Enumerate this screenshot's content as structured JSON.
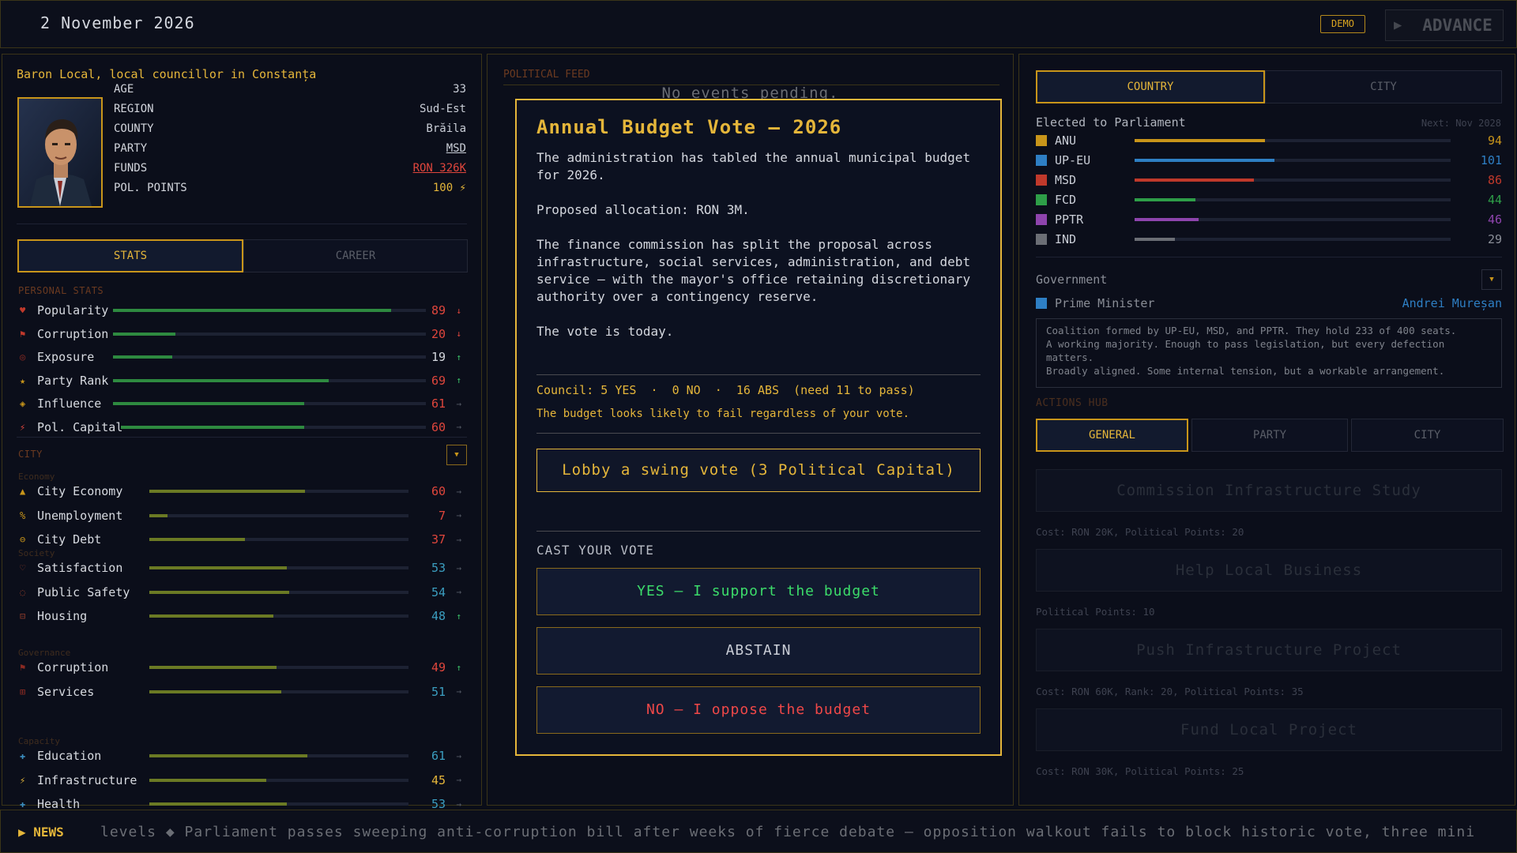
{
  "topbar": {
    "date": "2 November 2026",
    "demo_label": "DEMO",
    "advance_label": "ADVANCE"
  },
  "profile": {
    "name": "Baron Local, local councillor in Constanța",
    "fields": [
      {
        "key": "AGE",
        "value": "33"
      },
      {
        "key": "REGION",
        "value": "Sud-Est"
      },
      {
        "key": "COUNTY",
        "value": "Brăila"
      },
      {
        "key": "PARTY",
        "value": "MSD"
      },
      {
        "key": "FUNDS",
        "value": "RON 326K"
      },
      {
        "key": "POL. POINTS",
        "value": "100 ⚡"
      }
    ]
  },
  "left_tabs": {
    "stats": "STATS",
    "career": "CAREER"
  },
  "personal_stats": {
    "label": "PERSONAL STATS",
    "items": [
      {
        "icon": "heart-icon",
        "glyph": "♥",
        "name": "Popularity",
        "value": 89,
        "trend": "↓",
        "color": "#e0463c"
      },
      {
        "icon": "flag-icon",
        "glyph": "⚑",
        "name": "Corruption",
        "value": 20,
        "trend": "↓",
        "color": "#e0463c"
      },
      {
        "icon": "target-icon",
        "glyph": "◎",
        "name": "Exposure",
        "value": 19,
        "trend": "↑",
        "color": "#d4d7de"
      },
      {
        "icon": "star-icon",
        "glyph": "★",
        "name": "Party Rank",
        "value": 69,
        "trend": "↑",
        "color": "#e0463c"
      },
      {
        "icon": "diamond-icon",
        "glyph": "◈",
        "name": "Influence",
        "value": 61,
        "trend": "→",
        "color": "#e0463c"
      },
      {
        "icon": "bolt-icon",
        "glyph": "⚡",
        "name": "Pol. Capital",
        "value": 60,
        "trend": "→",
        "color": "#e0463c"
      }
    ]
  },
  "city": {
    "label": "CITY",
    "groups": [
      {
        "label": "Economy",
        "items": [
          {
            "glyph": "▲",
            "name": "City Economy",
            "value": 60,
            "trend": "→",
            "color": "#e0463c"
          },
          {
            "glyph": "%",
            "name": "Unemployment",
            "value": 7,
            "trend": "→",
            "color": "#e0463c"
          },
          {
            "glyph": "⊖",
            "name": "City Debt",
            "value": 37,
            "trend": "→",
            "color": "#e0463c"
          }
        ]
      },
      {
        "label": "Society",
        "items": [
          {
            "glyph": "♡",
            "name": "Satisfaction",
            "value": 53,
            "trend": "→",
            "color": "#3b9ec0"
          },
          {
            "glyph": "◌",
            "name": "Public Safety",
            "value": 54,
            "trend": "→",
            "color": "#3b9ec0"
          },
          {
            "glyph": "⊟",
            "name": "Housing",
            "value": 48,
            "trend": "↑",
            "color": "#3b9ec0"
          }
        ]
      },
      {
        "label": "Governance",
        "items": [
          {
            "glyph": "⚑",
            "name": "Corruption",
            "value": 49,
            "trend": "↑",
            "color": "#e0463c"
          },
          {
            "glyph": "⊞",
            "name": "Services",
            "value": 51,
            "trend": "→",
            "color": "#3b9ec0"
          }
        ]
      },
      {
        "label": "Capacity",
        "items": [
          {
            "glyph": "✚",
            "name": "Education",
            "value": 61,
            "trend": "→",
            "color": "#3b9ec0"
          },
          {
            "glyph": "⚡",
            "name": "Infrastructure",
            "value": 45,
            "trend": "→",
            "color": "#e5b63a"
          },
          {
            "glyph": "✚",
            "name": "Health",
            "value": 53,
            "trend": "→",
            "color": "#3b9ec0"
          }
        ]
      }
    ]
  },
  "feed": {
    "label": "POLITICAL FEED",
    "empty": "No events pending."
  },
  "modal": {
    "title": "Annual Budget Vote — 2026",
    "body": "The administration has tabled the annual municipal budget for 2026.\n\nProposed allocation: RON 3M.\n\nThe finance commission has split the proposal across infrastructure, social services, administration, and debt service — with the mayor's office retaining discretionary authority over a contingency reserve.\n\nThe vote is today.",
    "council": "Council: 5 YES  ·  0 NO  ·  16 ABS  (need 11 to pass)",
    "likely": "The budget looks likely to fail regardless of your vote.",
    "lobby": "Lobby a swing vote  (3 Political Capital)",
    "cast_label": "CAST YOUR VOTE",
    "yes": "YES — I support the budget",
    "abstain": "ABSTAIN",
    "no": "NO — I oppose the budget"
  },
  "right_tabs": {
    "country": "COUNTRY",
    "city": "CITY"
  },
  "parliament": {
    "label": "Elected to Parliament",
    "next": "Next: Nov 2028",
    "parties": [
      {
        "name": "ANU",
        "value": 94,
        "color": "#c8951a"
      },
      {
        "name": "UP-EU",
        "value": 101,
        "color": "#2e7fc4"
      },
      {
        "name": "MSD",
        "value": 86,
        "color": "#c0392b"
      },
      {
        "name": "FCD",
        "value": 44,
        "color": "#2e9e48"
      },
      {
        "name": "PPTR",
        "value": 46,
        "color": "#8e44ad"
      },
      {
        "name": "IND",
        "value": 29,
        "color": "#6b6e75"
      }
    ]
  },
  "government": {
    "label": "Government",
    "pm_label": "Prime Minister",
    "pm_name": "Andrei Mureșan",
    "summary_1": "Coalition formed by UP-EU, MSD, and PPTR. They hold 233 of 400 seats.",
    "summary_2": "A working majority. Enough to pass legislation, but every defection matters.",
    "summary_3": "Broadly aligned. Some internal tension, but a workable arrangement."
  },
  "actions": {
    "label": "ACTIONS HUB",
    "tabs": [
      "GENERAL",
      "PARTY",
      "CITY"
    ],
    "items": [
      {
        "title": "Commission Infrastructure Study",
        "cost": "Cost: RON 20K, Political Points: 20"
      },
      {
        "title": "Help Local Business",
        "cost": "Political Points: 10"
      },
      {
        "title": "Push Infrastructure Project",
        "cost": "Cost: RON 60K, Rank: 20, Political Points: 35"
      },
      {
        "title": "Fund Local Project",
        "cost": "Cost: RON 30K, Political Points: 25"
      }
    ]
  },
  "ticker": {
    "label": "NEWS",
    "text": "levels   ◆   Parliament passes sweeping anti-corruption bill after weeks of fierce debate — opposition walkout fails to block historic vote, three mini"
  }
}
